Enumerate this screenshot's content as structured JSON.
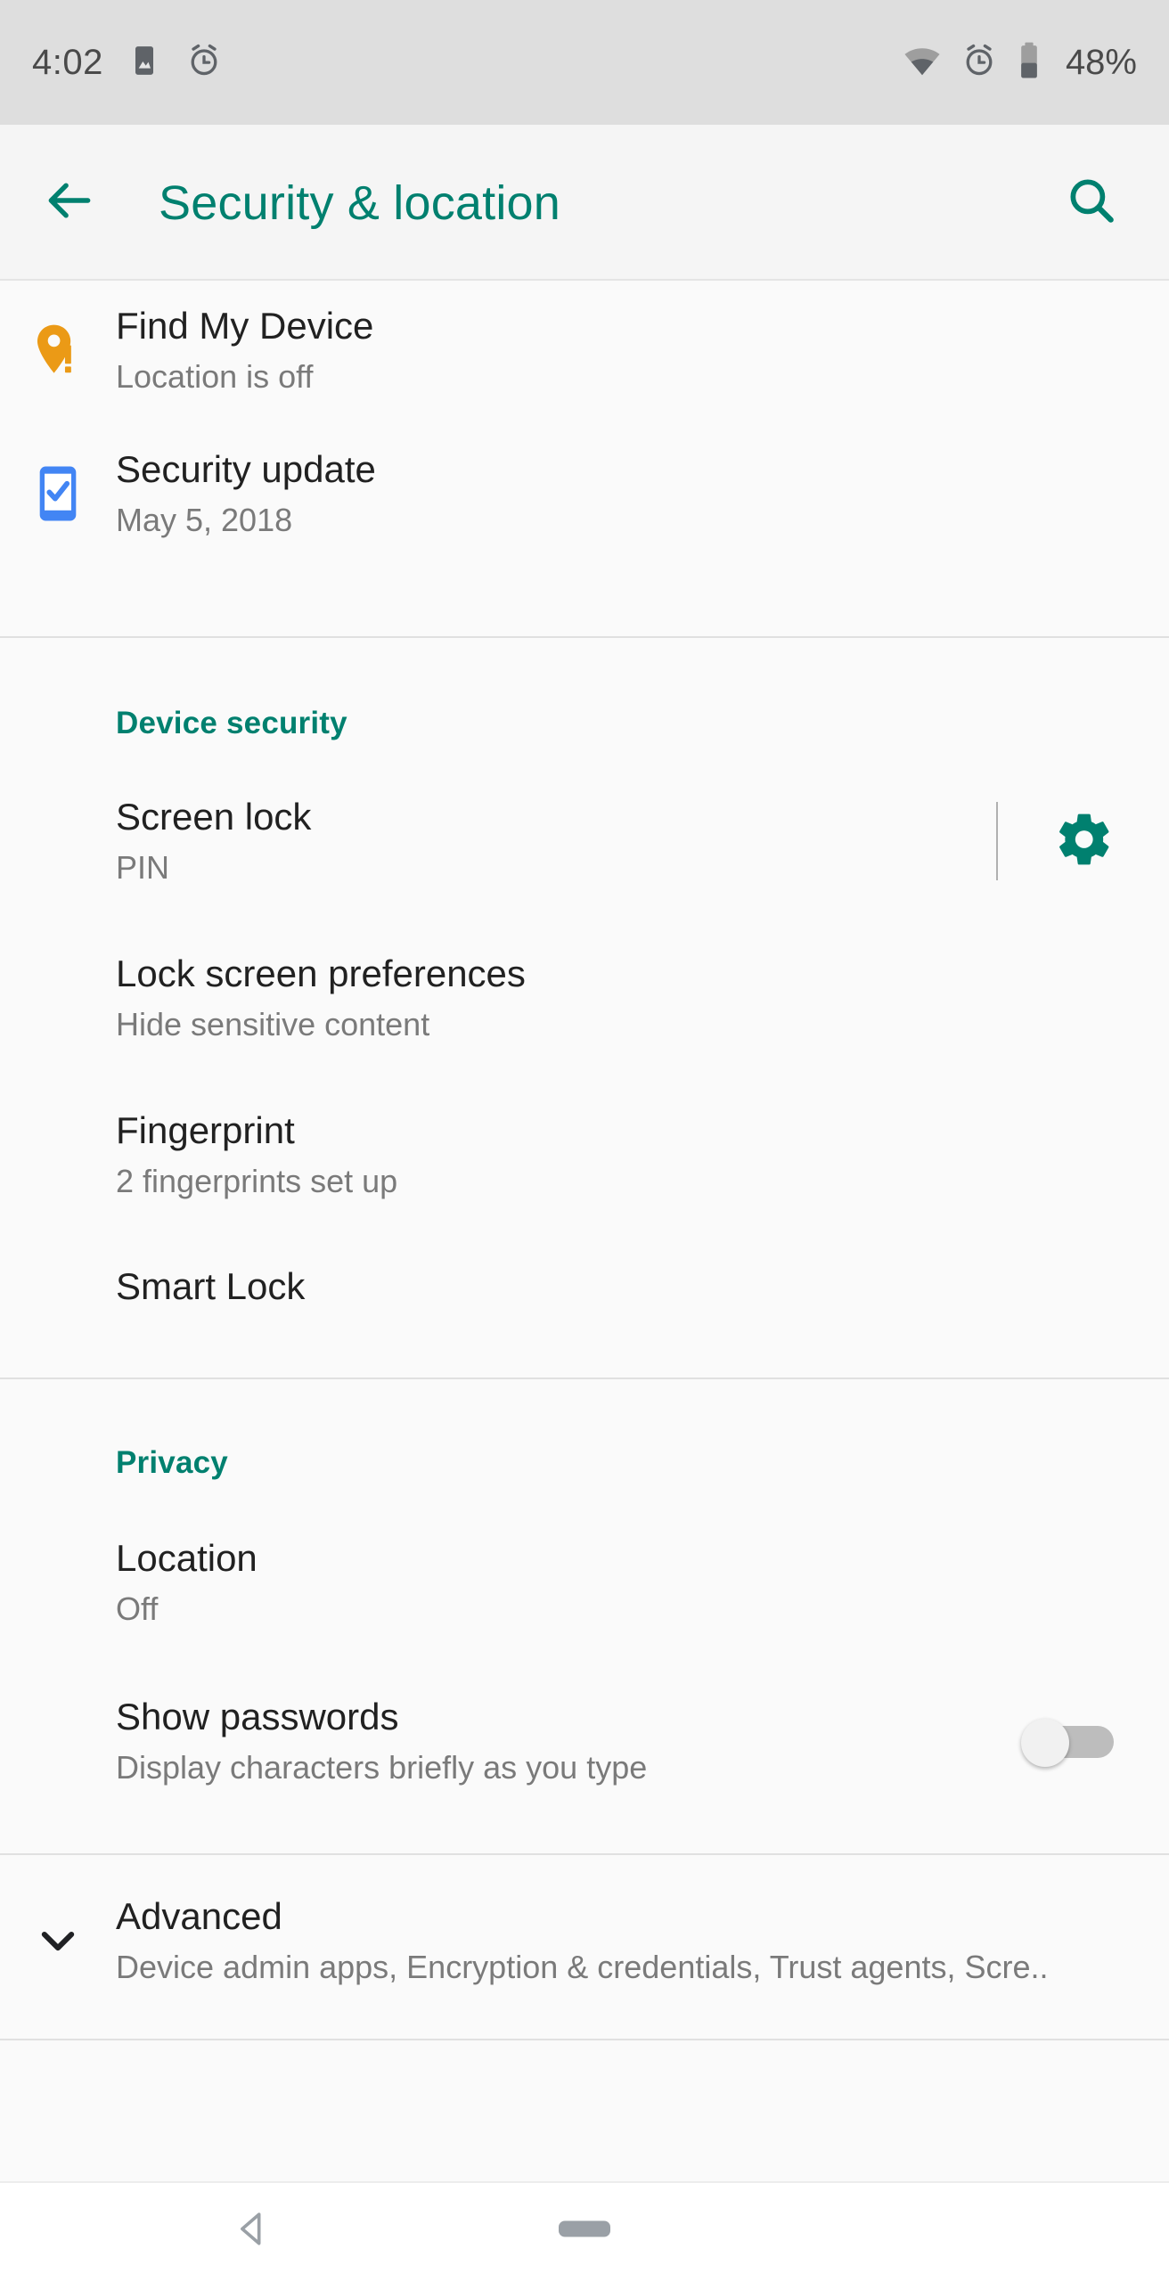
{
  "status_bar": {
    "time": "4:02",
    "battery_percent": "48%",
    "left_icons": [
      "image-icon",
      "alarm-icon"
    ],
    "right_icons": [
      "wifi-icon",
      "alarm-icon",
      "battery-icon"
    ],
    "background_color": "#dedede",
    "icon_color": "#5f6368"
  },
  "app_bar": {
    "title": "Security & location",
    "back_icon": "arrow-back-icon",
    "search_icon": "search-icon",
    "accent_color": "#00806f",
    "background_color": "#f5f5f5"
  },
  "top_items": [
    {
      "icon": "location-pin-alert-icon",
      "icon_color": "#eb9A16",
      "title": "Find My Device",
      "subtitle": "Location is off"
    },
    {
      "icon": "phone-check-icon",
      "icon_color": "#4285f4",
      "title": "Security update",
      "subtitle": "May 5, 2018"
    }
  ],
  "sections": [
    {
      "label": "Device security",
      "items": [
        {
          "title": "Screen lock",
          "subtitle": "PIN",
          "widget": "settings-gear",
          "widget_icon": "gear-icon",
          "widget_color": "#00806f"
        },
        {
          "title": "Lock screen preferences",
          "subtitle": "Hide sensitive content",
          "widget": "none"
        },
        {
          "title": "Fingerprint",
          "subtitle": "2 fingerprints set up",
          "widget": "none"
        },
        {
          "title": "Smart Lock",
          "subtitle": "",
          "widget": "none"
        }
      ]
    },
    {
      "label": "Privacy",
      "items": [
        {
          "title": "Location",
          "subtitle": "Off",
          "widget": "none"
        },
        {
          "title": "Show passwords",
          "subtitle": "Display characters briefly as you type",
          "widget": "toggle",
          "toggle_on": false
        }
      ]
    }
  ],
  "advanced": {
    "icon": "chevron-down-icon",
    "title": "Advanced",
    "subtitle": "Device admin apps, Encryption & credentials, Trust agents, Scre.."
  },
  "nav_bar": {
    "back_icon": "nav-back-triangle-icon",
    "home_icon": "nav-home-pill-icon",
    "icon_color": "#9aa0a6",
    "background_color": "#ffffff"
  }
}
